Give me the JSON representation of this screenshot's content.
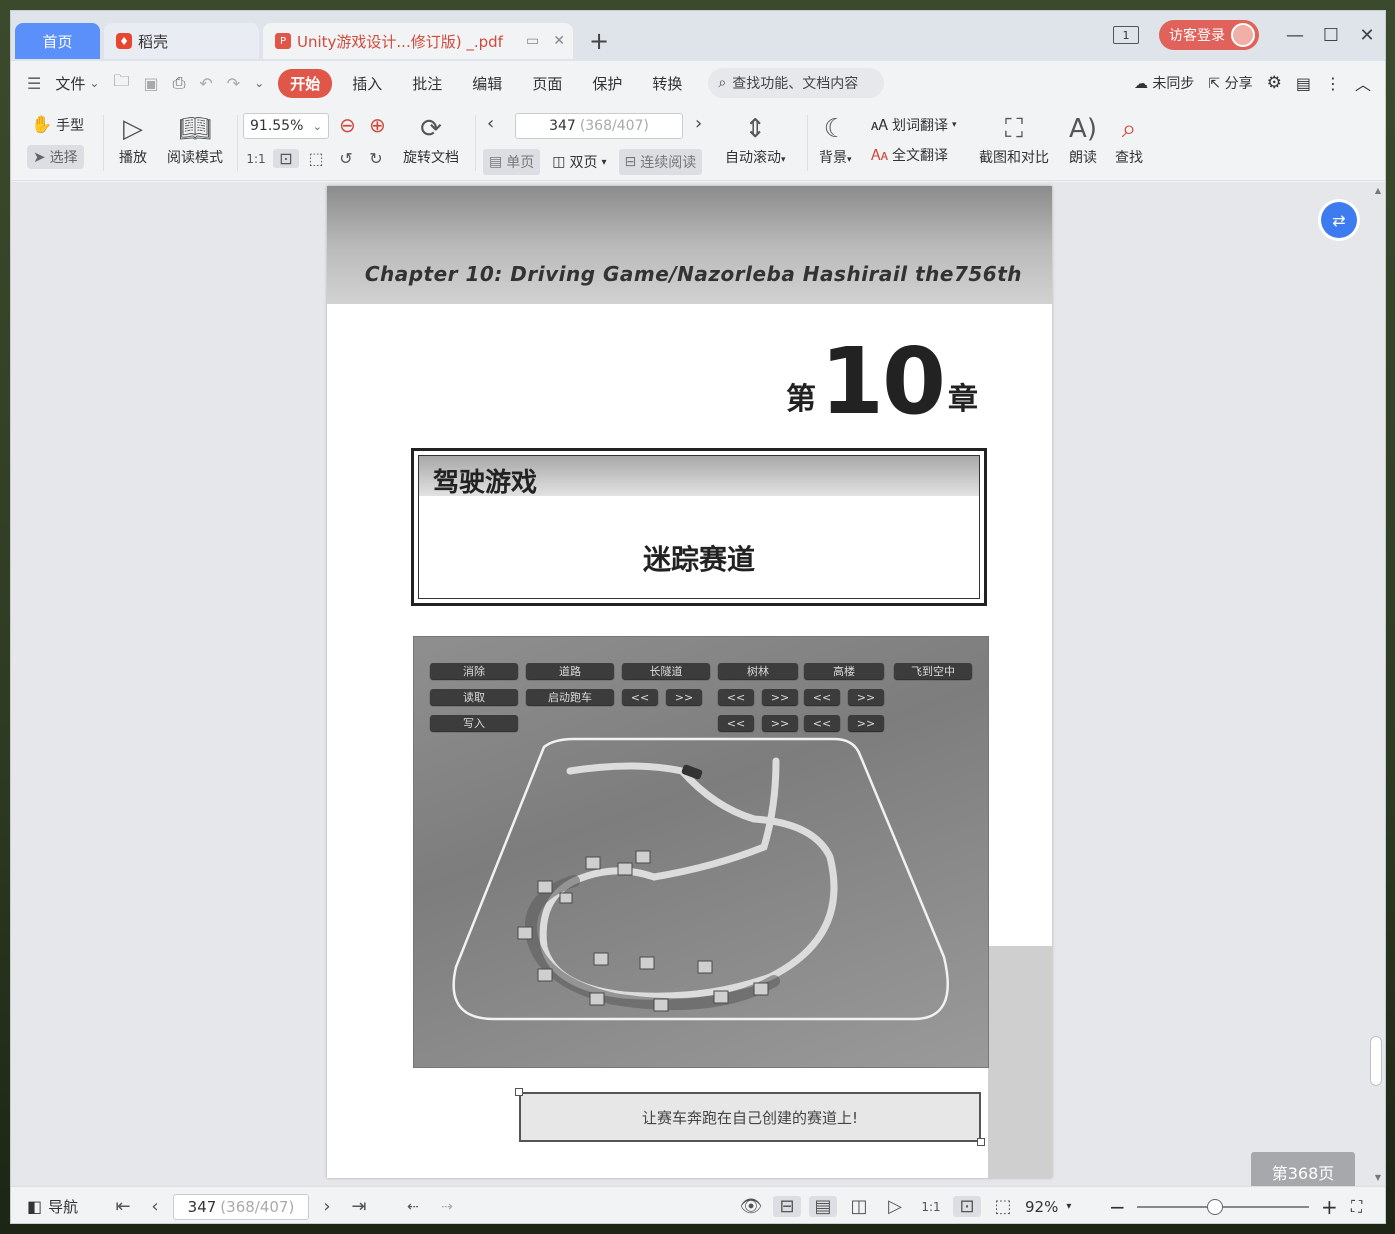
{
  "tabs": {
    "home": "首页",
    "daoke": "稻壳",
    "doc_title": "Unity游戏设计...修订版) _.pdf"
  },
  "window": {
    "page_count_badge": "1",
    "login": "访客登录"
  },
  "menu": {
    "file": "文件",
    "start": "开始",
    "insert": "插入",
    "annotate": "批注",
    "edit": "编辑",
    "page": "页面",
    "protect": "保护",
    "convert": "转换",
    "search_placeholder": "查找功能、文档内容",
    "sync": "未同步",
    "share": "分享"
  },
  "toolbar": {
    "hand": "手型",
    "select": "选择",
    "play": "播放",
    "read_mode": "阅读模式",
    "zoom_value": "91.55%",
    "rotate": "旋转文档",
    "page_current": "347",
    "page_total": "(368/407)",
    "single": "单页",
    "double": "双页",
    "continuous": "连续阅读",
    "auto_scroll": "自动滚动",
    "background": "背景",
    "word_translate": "划词翻译",
    "full_translate": "全文翻译",
    "screenshot_compare": "截图和对比",
    "read_aloud": "朗读",
    "find": "查找"
  },
  "page": {
    "chapter_line": "Chapter 10: Driving Game/Nazorleba Hashirail the756th",
    "chapter_prefix": "第",
    "chapter_number": "10",
    "chapter_suffix": "章",
    "title_main": "驾驶游戏",
    "title_sub": "迷踪赛道",
    "caption": "让赛车奔跑在自己创建的赛道上!",
    "game_buttons": {
      "erase": "消除",
      "road": "道路",
      "long_tunnel": "长隧道",
      "forest": "树林",
      "tall_building": "高楼",
      "fly": "飞到空中",
      "load": "读取",
      "start_car": "启动跑车",
      "prev": "<<",
      "next": ">>",
      "write": "写入"
    }
  },
  "page_badge": "第368页",
  "statusbar": {
    "nav": "导航",
    "page_current": "347",
    "page_total": "(368/407)",
    "zoom": "92%"
  }
}
